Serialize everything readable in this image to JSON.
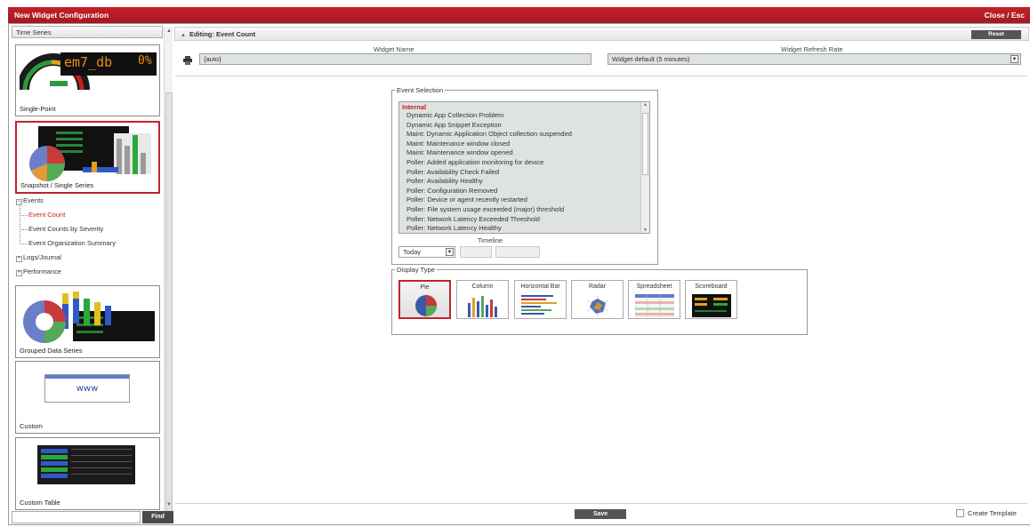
{
  "window": {
    "title": "New Widget Configuration",
    "close_label": "Close / Esc"
  },
  "sidebar": {
    "header": "Time Series",
    "cards": {
      "single_point": {
        "label": "Single-Point",
        "display_text": "em7_db",
        "display_value": "0%"
      },
      "snapshot": {
        "label": "Snapshot / Single Series"
      },
      "grouped": {
        "label": "Grouped Data Series"
      },
      "custom": {
        "label": "Custom",
        "display_text": "www"
      },
      "custom_table": {
        "label": "Custom Table"
      }
    },
    "tree": {
      "events": "Events",
      "event_count": "Event Count",
      "event_counts_by_severity": "Event Counts by Severity",
      "event_org_summary": "Event Organization Summary",
      "logs": "Logs/Journal",
      "performance": "Performance"
    },
    "find_button": "Find",
    "find_value": ""
  },
  "editor": {
    "title": "Editing: Event Count",
    "reset_label": "Reset",
    "widget_name_label": "Widget Name",
    "widget_name_value": "{auto}",
    "refresh_label": "Widget Refresh Rate",
    "refresh_value": "Widget default (5 minutes)"
  },
  "event_selection": {
    "legend": "Event Selection",
    "group": "Internal",
    "items": [
      "Dynamic App Collection Problem",
      "Dynamic App Snippet Exception",
      "Maint: Dynamic Application Object collection suspended",
      "Maint: Maintenance window closed",
      "Maint: Maintenance window opened",
      "Poller: Added application monitoring for device",
      "Poller: Availability Check Failed",
      "Poller: Availability Healthy",
      "Poller: Configuration Removed",
      "Poller: Device or agent recently restarted",
      "Poller: File system usage exceeded (major) threshold",
      "Poller: Network Latency Exceeded Threshold",
      "Poller: Network Latency Healthy"
    ],
    "timeline_label": "Timeline",
    "timeline_value": "Today"
  },
  "display_type": {
    "legend": "Display Type",
    "options": {
      "pie": "Pie",
      "column": "Column",
      "horizontal_bar": "Horizontal Bar",
      "radar": "Radar",
      "spreadsheet": "Spreadsheet",
      "scoreboard": "Scoreboard"
    },
    "selected": "Pie"
  },
  "footer": {
    "save_label": "Save",
    "create_template_label": "Create Template"
  },
  "colors": {
    "accent": "#c5222a",
    "field_bg": "#dfe3e0"
  }
}
